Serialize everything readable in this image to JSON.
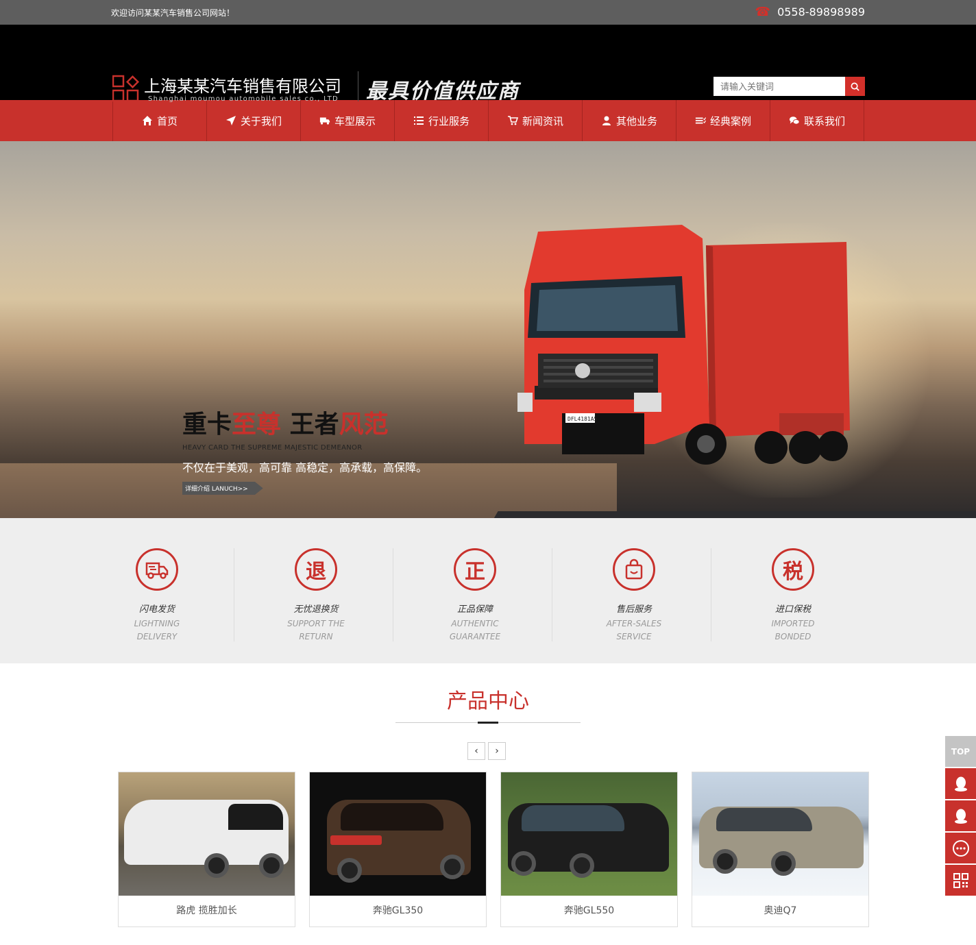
{
  "topbar": {
    "welcome": "欢迎访问某某汽车销售公司网站！",
    "phone": "0558-89898989",
    "phone_icon": "phone-icon"
  },
  "header": {
    "company_cn": "上海某某汽车销售有限公司",
    "company_en": "Shanghai moumou automobile sales co., LTD",
    "slogan": "最具价值供应商",
    "search_placeholder": "请输入关键词"
  },
  "nav": {
    "items": [
      {
        "label": "首页",
        "icon": "home-icon"
      },
      {
        "label": "关于我们",
        "icon": "send-icon"
      },
      {
        "label": "车型展示",
        "icon": "truck-icon"
      },
      {
        "label": "行业服务",
        "icon": "list-icon"
      },
      {
        "label": "新闻资讯",
        "icon": "cart-icon"
      },
      {
        "label": "其他业务",
        "icon": "user-icon"
      },
      {
        "label": "经典案例",
        "icon": "list-check-icon"
      },
      {
        "label": "联系我们",
        "icon": "chat-icon"
      }
    ]
  },
  "banner": {
    "title_a": "重卡",
    "title_b": "至尊",
    "title_c": "王者",
    "title_d": "风范",
    "subtitle": "HEAVY CARD THE SUPREME MAJESTIC DEMEANOR",
    "desc": "不仅在于美观，高可靠 高稳定，高承载，高保障。",
    "more": "详细介绍 LANUCH>>",
    "plate": "DFL4181A5",
    "slides": 4,
    "active_slide": 4
  },
  "features": [
    {
      "glyph": "车",
      "cn": "闪电发货",
      "en1": "LIGHTNING",
      "en2": "DELIVERY"
    },
    {
      "glyph": "退",
      "cn": "无忧退换货",
      "en1": "SUPPORT THE",
      "en2": "RETURN"
    },
    {
      "glyph": "正",
      "cn": "正品保障",
      "en1": "AUTHENTIC",
      "en2": "GUARANTEE"
    },
    {
      "glyph": "袋",
      "cn": "售后服务",
      "en1": "AFTER-SALES",
      "en2": "SERVICE"
    },
    {
      "glyph": "税",
      "cn": "进口保税",
      "en1": "IMPORTED",
      "en2": "BONDED"
    }
  ],
  "products": {
    "title": "产品中心",
    "prev": "‹",
    "next": "›",
    "items": [
      {
        "name": "路虎 揽胜加长",
        "bg": "#9a8a6a",
        "car": "#e8e8e8"
      },
      {
        "name": "奔驰GL350",
        "bg": "#0e0e0e",
        "car": "#4b3526"
      },
      {
        "name": "奔驰GL550",
        "bg": "#4f6b32",
        "car": "#1d1d1d"
      },
      {
        "name": "奥迪Q7",
        "bg": "#c7d5e4",
        "car": "#9e9785"
      }
    ]
  },
  "sidebar": {
    "top": "TOP"
  },
  "colors": {
    "brand_red": "#c8312c",
    "topbar": "#5e5e5e",
    "header": "#000000"
  }
}
